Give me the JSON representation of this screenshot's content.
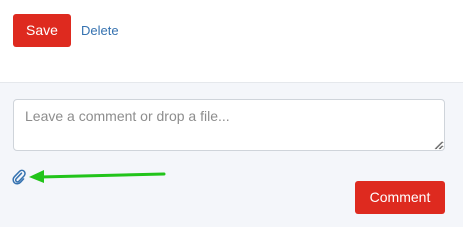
{
  "actions": {
    "save_label": "Save",
    "delete_label": "Delete"
  },
  "comment": {
    "placeholder": "Leave a comment or drop a file...",
    "value": "",
    "submit_label": "Comment"
  },
  "icons": {
    "attach": "paperclip-icon",
    "annotation": "green-arrow"
  },
  "colors": {
    "primary_button": "#de2a1f",
    "link": "#3572b0",
    "attach_icon": "#3572b0",
    "annotation_arrow": "#22c41a",
    "bottom_panel": "#f4f6fa"
  }
}
